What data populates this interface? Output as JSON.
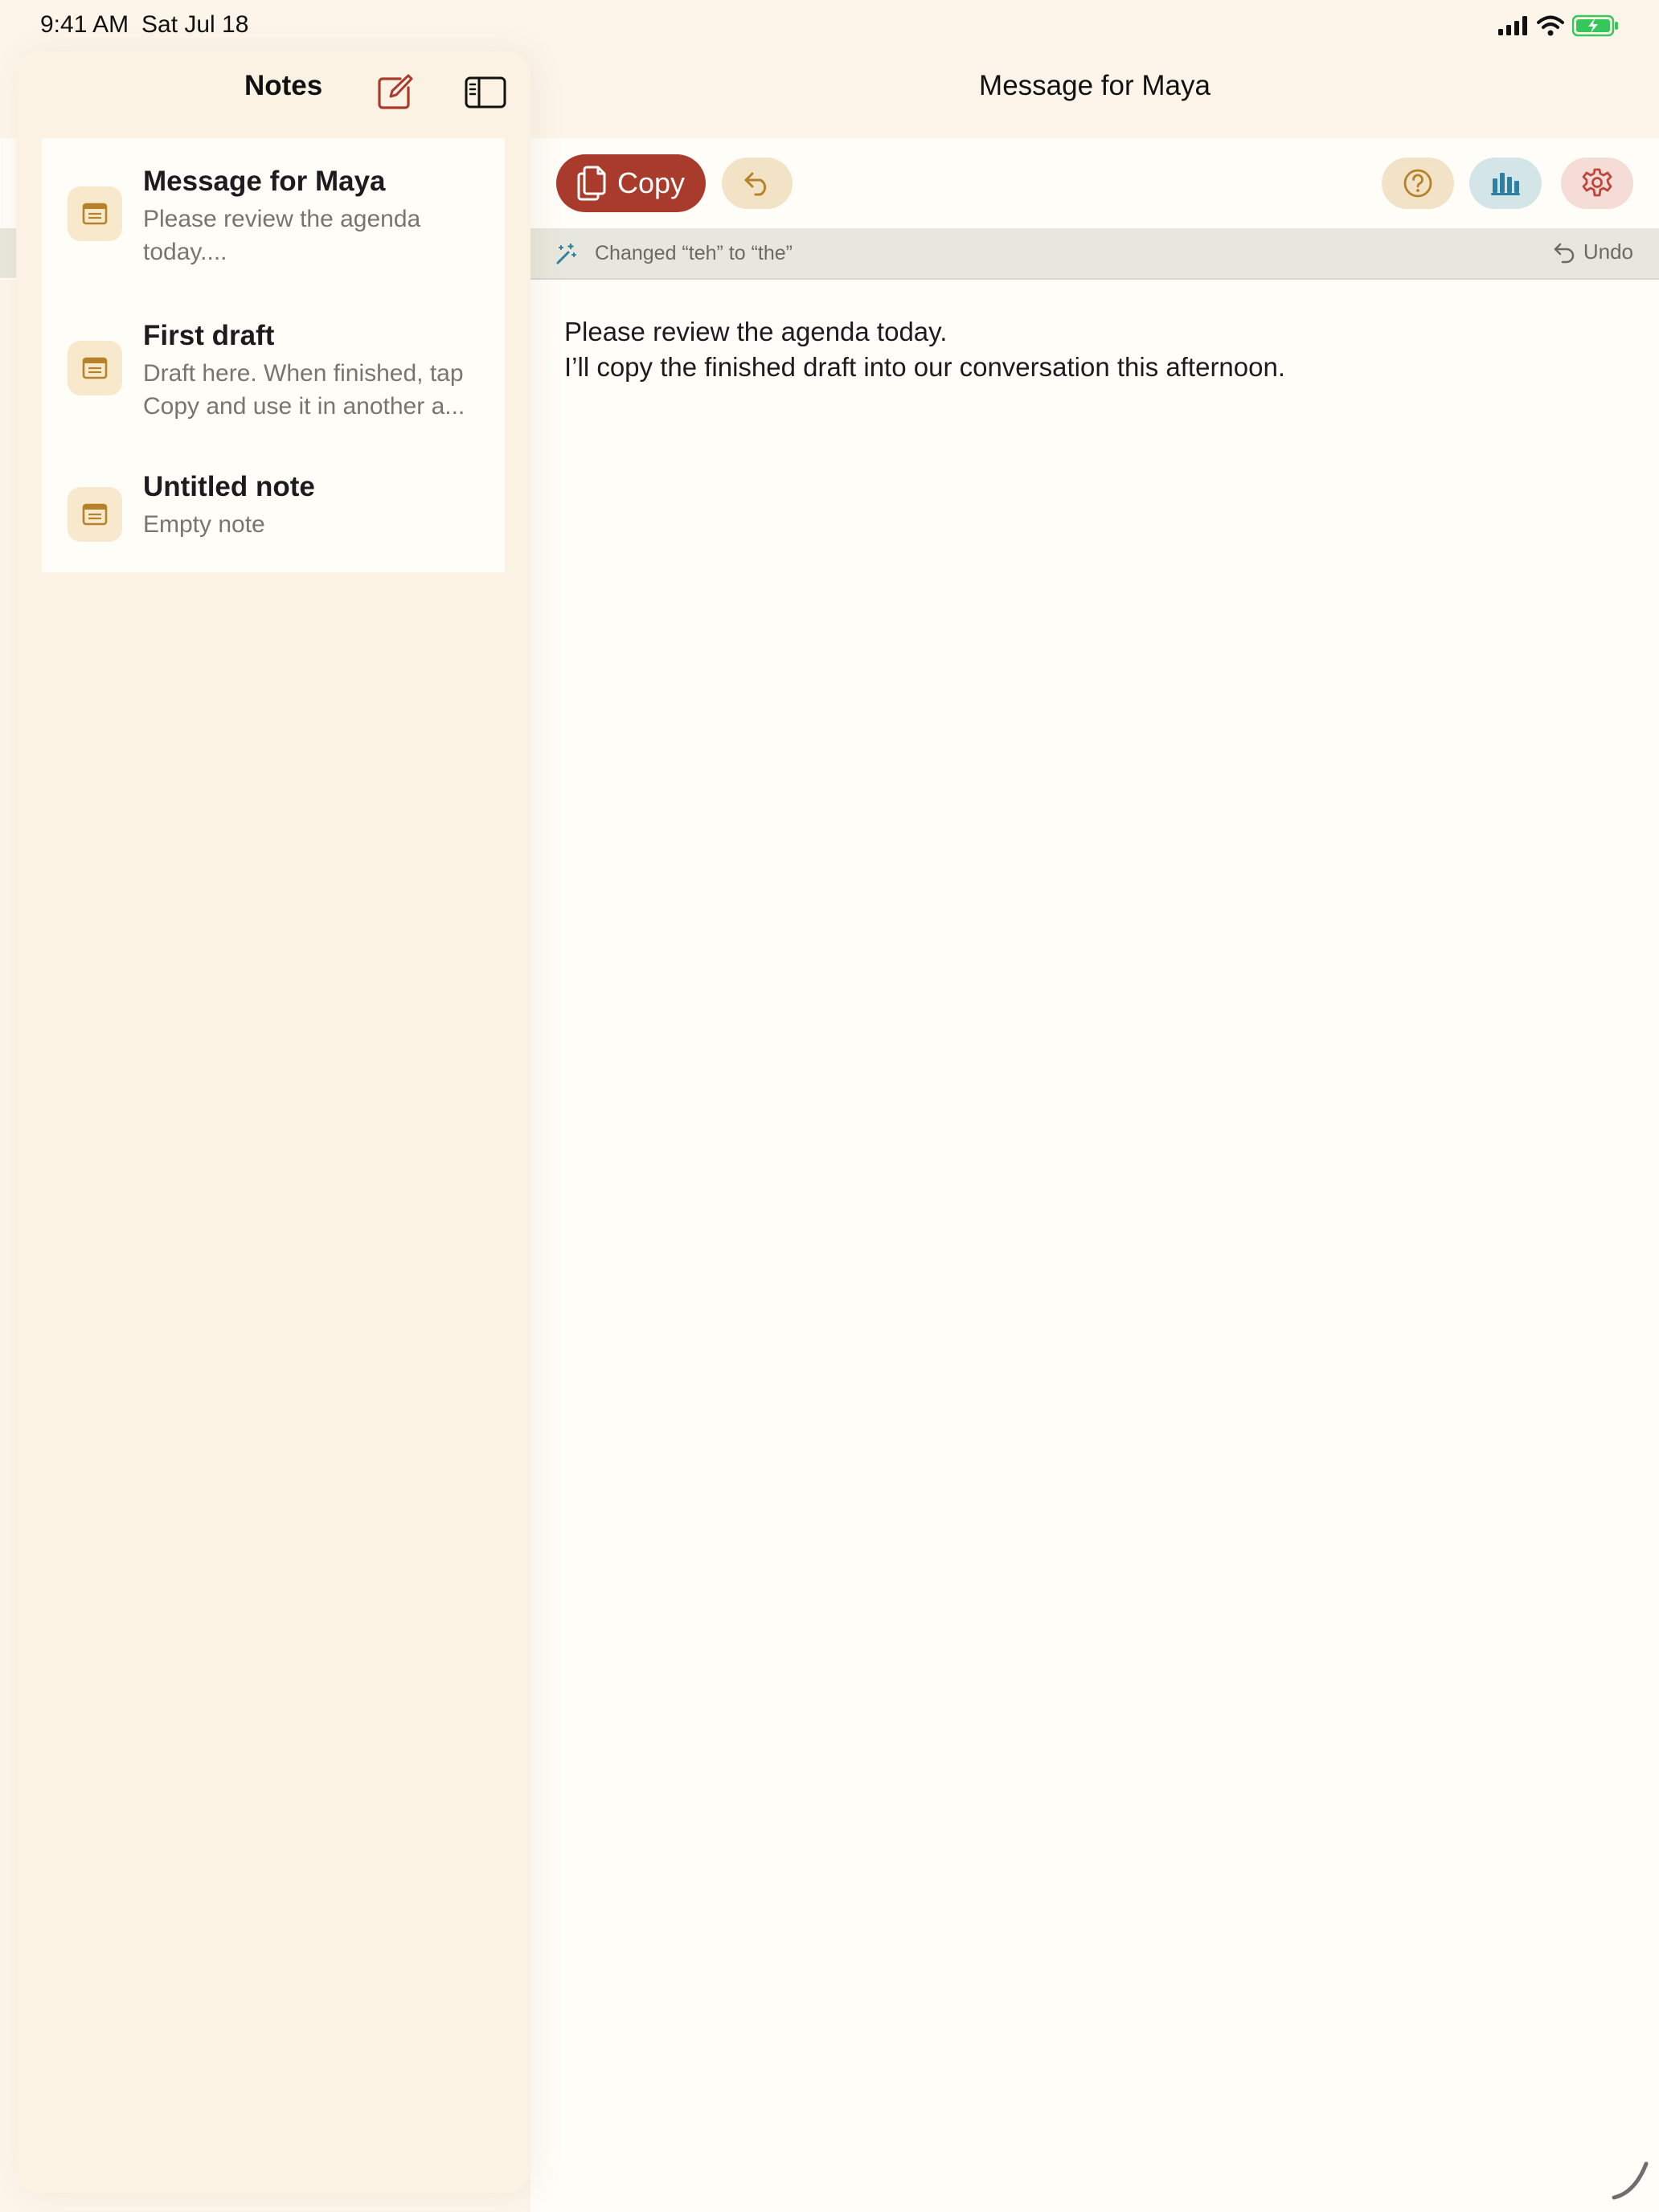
{
  "status_bar": {
    "time": "9:41 AM",
    "date": "Sat Jul 18"
  },
  "sidebar": {
    "title": "Notes",
    "notes": [
      {
        "title": "Message for Maya",
        "preview": "Please review the agenda today...."
      },
      {
        "title": "First draft",
        "preview": "Draft here. When finished, tap Copy and use it in another a..."
      },
      {
        "title": "Untitled note",
        "preview": "Empty note"
      }
    ]
  },
  "detail": {
    "title": "Message for Maya",
    "toolbar": {
      "copy_label": "Copy"
    },
    "banner": {
      "message": "Changed “teh” to “the”",
      "undo_label": "Undo"
    },
    "body_lines": [
      "Please review the agenda today.",
      "I’ll copy the finished draft into our conversation this afternoon."
    ]
  },
  "colors": {
    "accent_red": "#a93b2d",
    "accent_gold": "#b5822a",
    "stats_blue": "#2f7fa0",
    "background": "#fdf5ea",
    "battery_green": "#34c759"
  }
}
